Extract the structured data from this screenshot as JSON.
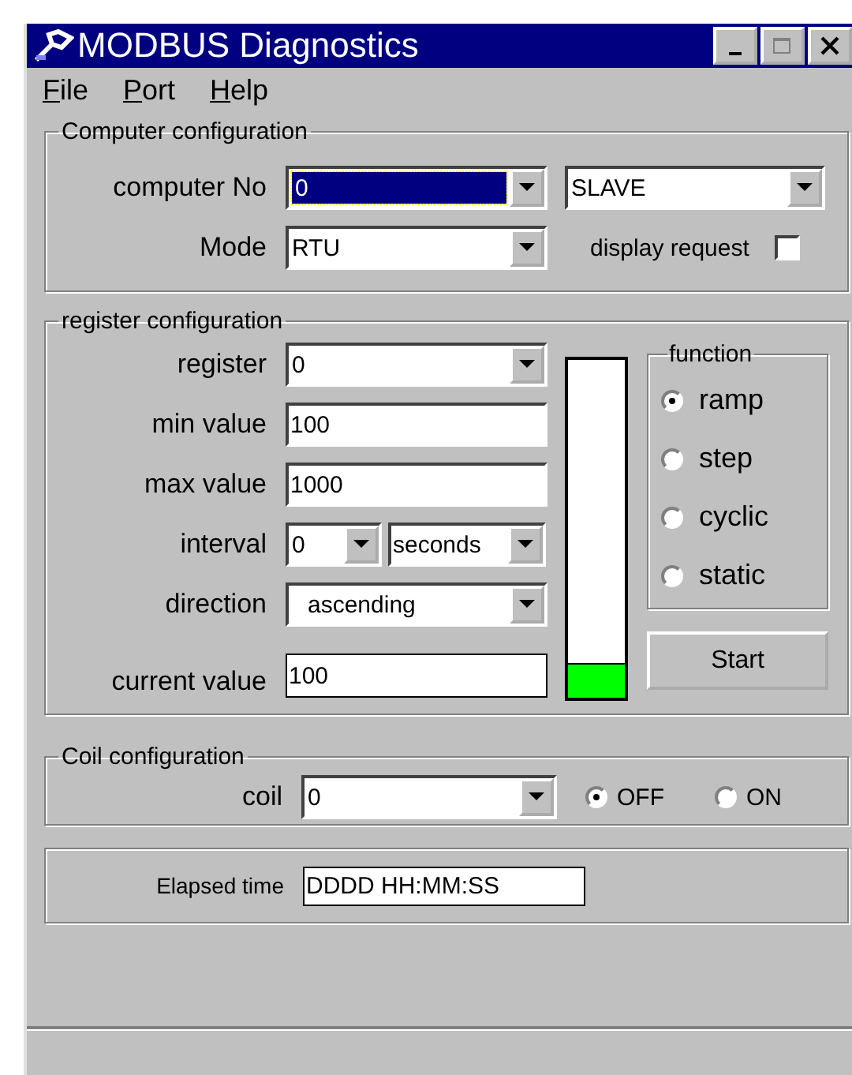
{
  "window": {
    "title": "MODBUS Diagnostics"
  },
  "menu": [
    {
      "label": "File"
    },
    {
      "label": "Port"
    },
    {
      "label": "Help"
    }
  ],
  "computer_configuration": {
    "title": "Computer configuration",
    "computer_no": {
      "label": "computer No",
      "value": "0",
      "highlighted": true
    },
    "role": {
      "value": "SLAVE"
    },
    "mode": {
      "label": "Mode",
      "value": "RTU"
    },
    "display_request": {
      "label": "display request",
      "checked": false
    }
  },
  "register_configuration": {
    "title": "register configuration",
    "register": {
      "label": "register",
      "value": "0"
    },
    "min_value": {
      "label": "min value",
      "value": "100"
    },
    "max_value": {
      "label": "max value",
      "value": "1000"
    },
    "interval": {
      "label": "interval",
      "value": "0",
      "unit": "seconds"
    },
    "direction": {
      "label": "direction",
      "value": "ascending"
    },
    "current_value": {
      "label": "current value",
      "value": "100"
    },
    "level": 0.1,
    "function": {
      "title": "function",
      "options": [
        {
          "label": "ramp",
          "selected": true
        },
        {
          "label": "step",
          "selected": false
        },
        {
          "label": "cyclic",
          "selected": false
        },
        {
          "label": "static",
          "selected": false
        }
      ]
    },
    "start_button": "Start"
  },
  "coil_configuration": {
    "title": "Coil configuration",
    "coil": {
      "label": "coil",
      "value": "0"
    },
    "states": [
      {
        "label": "OFF",
        "selected": true
      },
      {
        "label": "ON",
        "selected": false
      }
    ]
  },
  "elapsed_time": {
    "label": "Elapsed time",
    "value": "DDDD HH:MM:SS"
  }
}
